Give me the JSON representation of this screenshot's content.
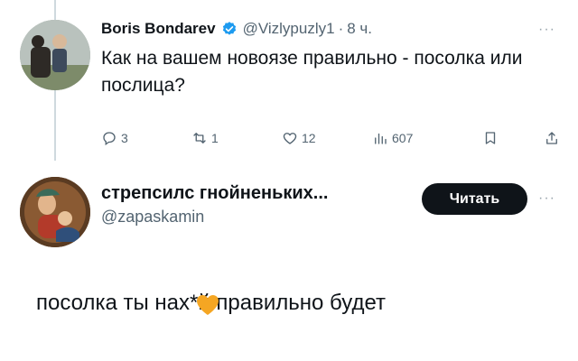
{
  "tweet": {
    "author_name": "Boris Bondarev",
    "handle": "@Vizlypuzly1",
    "separator": "·",
    "time": "8 ч.",
    "more_icon": "more-dots-icon",
    "text": "Как на вашем новоязе правильно - посолка или послица?",
    "actions": {
      "replies": "3",
      "reposts": "1",
      "likes": "12",
      "views": "607"
    },
    "verified_color": "#1d9bf0"
  },
  "reply": {
    "author_name": "стрепсилс гнойненьких...",
    "handle": "@zapaskamin",
    "follow_label": "Читать",
    "more_icon": "more-dots-icon"
  },
  "comment": {
    "text": "посолка ты нах*й правильно будет",
    "sticker_icon": "orange-heart-icon",
    "sticker_color": "#f5a623"
  }
}
